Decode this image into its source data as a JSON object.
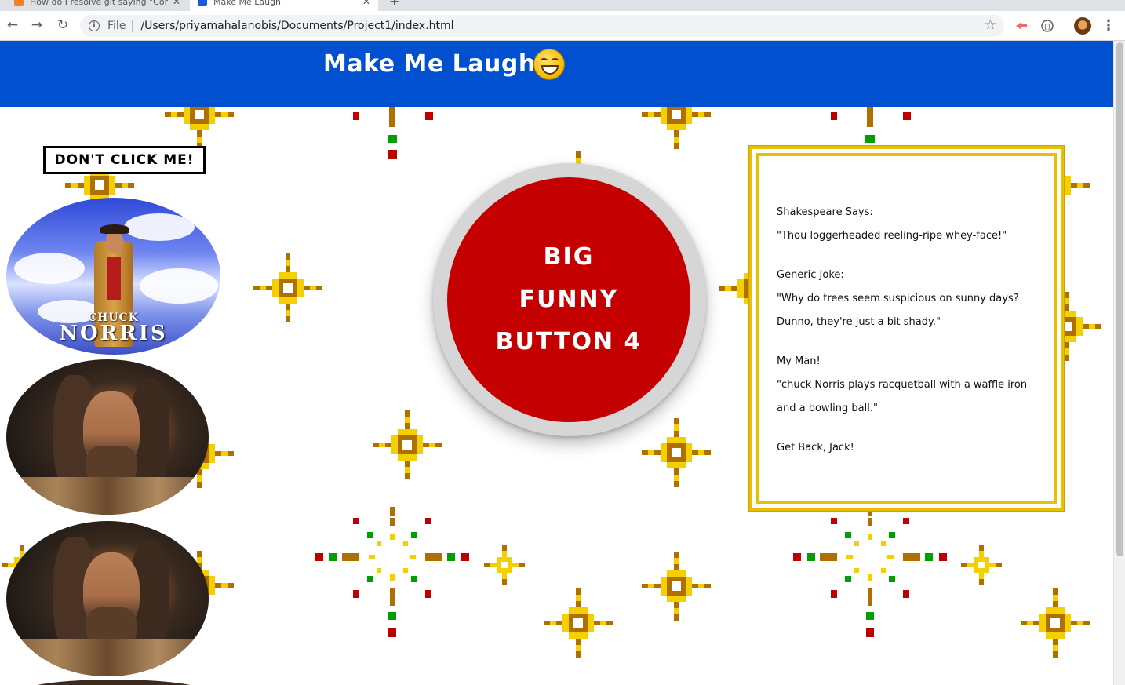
{
  "browser": {
    "tabs": [
      {
        "title": "How do I resolve git saying \"Com",
        "active": false
      },
      {
        "title": "Make Me Laugh",
        "active": true
      }
    ],
    "omnibox": {
      "scheme": "File",
      "url": "/Users/priyamahalanobis/Documents/Project1/index.html"
    },
    "icons": [
      "back-arrow-icon",
      "forward-arrow-icon",
      "reload-icon",
      "info-icon",
      "star-icon",
      "extension-icon",
      "extension-icon",
      "profile-avatar",
      "kebab-menu-icon"
    ]
  },
  "page": {
    "title": "Make Me Laugh!",
    "title_icon": "laughing-emoji-icon",
    "header_color": "#0050d0",
    "dont_click_label": "DON'T CLICK ME!",
    "photos": [
      {
        "caption_line1": "CHUCK",
        "caption_line2": "NORRIS"
      },
      {
        "caption_line1": "",
        "caption_line2": ""
      },
      {
        "caption_line1": "",
        "caption_line2": ""
      }
    ],
    "big_button": {
      "line1": "BIG FUNNY",
      "line2": "BUTTON 4",
      "color": "#c40000"
    },
    "jokes": {
      "shakespeare_heading": "Shakespeare Says:",
      "shakespeare_text": "\"Thou loggerheaded reeling-ripe whey-face!\"",
      "generic_heading": "Generic Joke:",
      "generic_text": "\"Why do trees seem suspicious on sunny days? Dunno, they're just a bit shady.\"",
      "man_heading": "My Man!",
      "man_text": "\"chuck Norris plays racquetball with a waffle iron and a bowling ball.\"",
      "footer": "Get Back, Jack!"
    }
  }
}
